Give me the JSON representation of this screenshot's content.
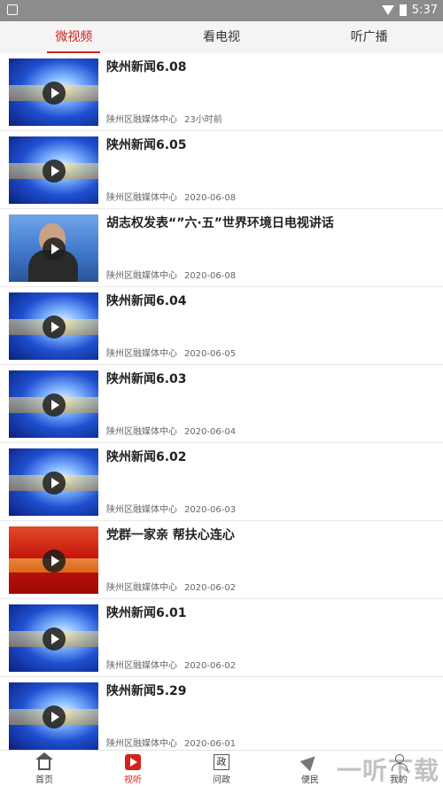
{
  "status_bar": {
    "time": "5:37"
  },
  "tabs": [
    {
      "label": "微视频",
      "active": true
    },
    {
      "label": "看电视",
      "active": false
    },
    {
      "label": "听广播",
      "active": false
    }
  ],
  "items": [
    {
      "title": "陕州新闻6.08",
      "source": "陕州区融媒体中心",
      "time": "23小时前",
      "thumb": "news"
    },
    {
      "title": "陕州新闻6.05",
      "source": "陕州区融媒体中心",
      "time": "2020-06-08",
      "thumb": "news"
    },
    {
      "title": "胡志权发表“”六·五”世界环境日电视讲话",
      "source": "陕州区融媒体中心",
      "time": "2020-06-08",
      "thumb": "person"
    },
    {
      "title": "陕州新闻6.04",
      "source": "陕州区融媒体中心",
      "time": "2020-06-05",
      "thumb": "news"
    },
    {
      "title": "陕州新闻6.03",
      "source": "陕州区融媒体中心",
      "time": "2020-06-04",
      "thumb": "news"
    },
    {
      "title": "陕州新闻6.02",
      "source": "陕州区融媒体中心",
      "time": "2020-06-03",
      "thumb": "news"
    },
    {
      "title": "党群一家亲 帮扶心连心",
      "source": "陕州区融媒体中心",
      "time": "2020-06-02",
      "thumb": "party"
    },
    {
      "title": "陕州新闻6.01",
      "source": "陕州区融媒体中心",
      "time": "2020-06-02",
      "thumb": "news"
    },
    {
      "title": "陕州新闻5.29",
      "source": "陕州区融媒体中心",
      "time": "2020-06-01",
      "thumb": "news"
    }
  ],
  "bottom_nav": [
    {
      "label": "首页",
      "icon": "home-icon",
      "active": false
    },
    {
      "label": "视听",
      "icon": "video-icon",
      "active": true
    },
    {
      "label": "问政",
      "icon": "gov-icon",
      "icon_text": "政",
      "active": false
    },
    {
      "label": "便民",
      "icon": "send-icon",
      "active": false
    },
    {
      "label": "我的",
      "icon": "user-icon",
      "active": false
    }
  ],
  "watermark": "一听下载",
  "colors": {
    "accent": "#d2231c"
  }
}
